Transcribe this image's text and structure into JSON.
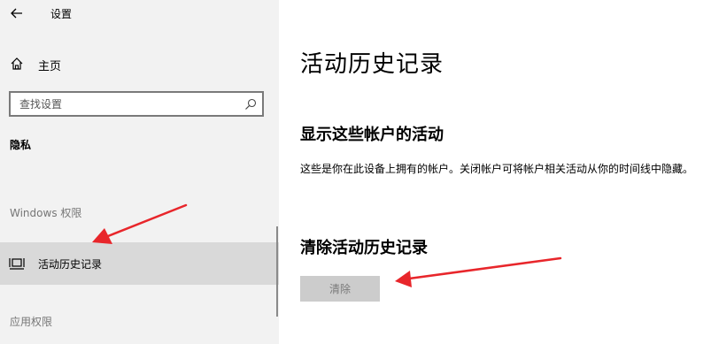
{
  "window": {
    "title": "设置"
  },
  "sidebar": {
    "home_label": "主页",
    "search_placeholder": "查找设置",
    "section_title": "隐私",
    "group_windows": "Windows 权限",
    "active_item_label": "活动历史记录",
    "group_apps": "应用权限"
  },
  "main": {
    "title": "活动历史记录",
    "accounts_heading": "显示这些帐户的活动",
    "accounts_description": "这些是你在此设备上拥有的帐户。关闭帐户可将帐户相关活动从你的时间线中隐藏。",
    "clear_heading": "清除活动历史记录",
    "clear_button": "清除"
  },
  "colors": {
    "sidebar_bg": "#f2f2f2",
    "selected_bg": "#d9d9d9",
    "disabled_button_bg": "#cccccc",
    "annotation_arrow": "#e8262b"
  },
  "icons": [
    "back-arrow-icon",
    "home-icon",
    "search-icon",
    "timeline-icon"
  ]
}
